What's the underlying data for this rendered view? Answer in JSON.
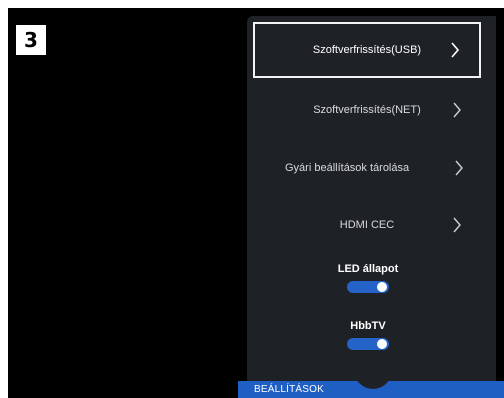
{
  "step_badge": "3",
  "menu": {
    "items": [
      {
        "label": "Szoftverfrissítés(USB)",
        "selected": true
      },
      {
        "label": "Szoftverfrissítés(NET)",
        "selected": false
      },
      {
        "label": "Gyári beállítások tárolása",
        "selected": false
      },
      {
        "label": "HDMI CEC",
        "selected": false
      }
    ],
    "toggles": [
      {
        "label": "LED állapot",
        "state": "on"
      },
      {
        "label": "HbbTV",
        "state": "on"
      }
    ]
  },
  "bottom_bar": {
    "label": "BEÁLLÍTÁSOK"
  },
  "colors": {
    "accent": "#2563c9",
    "panel": "#1e2227",
    "background": "#000000"
  },
  "icons": [
    "chevron-right-icon"
  ]
}
